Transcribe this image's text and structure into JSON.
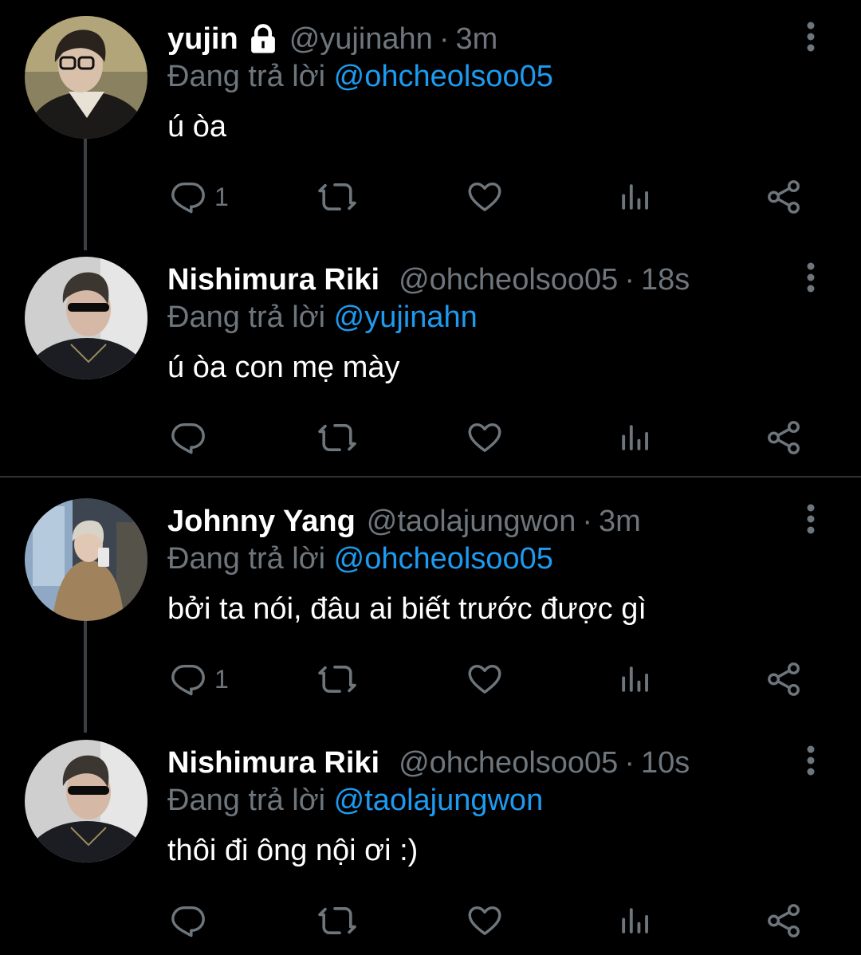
{
  "reply_prefix": "Đang trả lời",
  "icons": {
    "reply": "reply-icon",
    "retweet": "retweet-icon",
    "like": "like-icon",
    "views": "views-icon",
    "share": "share-icon",
    "more": "more-vertical-icon",
    "lock": "lock-icon"
  },
  "colors": {
    "background": "#000000",
    "accent": "#1d9bf0",
    "muted": "#6e767d",
    "thread_line": "#3a3f44"
  },
  "tweets": [
    {
      "name": "yujin",
      "locked": true,
      "handle": "@yujinahn",
      "time": "3m",
      "replying_to": "@ohcheolsoo05",
      "text": "ú òa",
      "reply_count": "1"
    },
    {
      "name": "Nishimura Riki",
      "handle": "@ohcheolsoo05",
      "time": "18s",
      "replying_to": "@yujinahn",
      "text": "ú òa con mẹ mày",
      "reply_count": ""
    },
    {
      "name": "Johnny Yang",
      "handle": "@taolajungwon",
      "time": "3m",
      "replying_to": "@ohcheolsoo05",
      "text": "bởi ta nói, đâu ai biết trước được gì",
      "reply_count": "1"
    },
    {
      "name": "Nishimura Riki",
      "handle": "@ohcheolsoo05",
      "time": "10s",
      "replying_to": "@taolajungwon",
      "text": "thôi đi ông nội ơi :)",
      "reply_count": ""
    }
  ]
}
